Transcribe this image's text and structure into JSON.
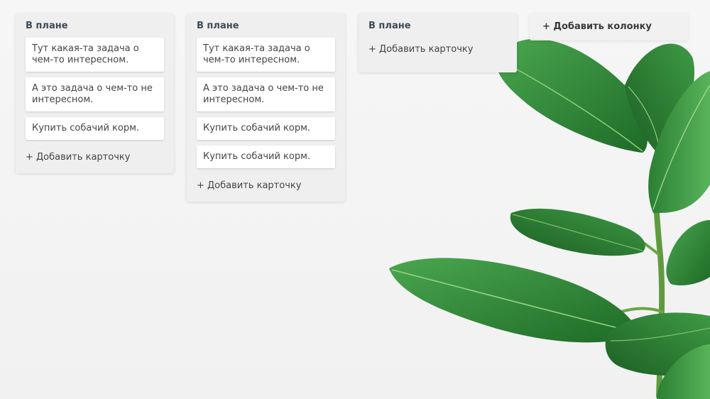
{
  "board": {
    "columns": [
      {
        "title": "В плане",
        "cards": [
          "Тут какая-та задача о чем-то интересном.",
          "А это задача о чем-то не интересном.",
          "Купить собачий корм."
        ],
        "add_card_label": "+ Добавить карточку"
      },
      {
        "title": "В плане",
        "cards": [
          "Тут какая-та задача о чем-то интересном.",
          "А это задача о чем-то не интересном.",
          "Купить собачий корм.",
          "Купить собачий корм."
        ],
        "add_card_label": "+ Добавить карточку"
      },
      {
        "title": "В плане",
        "cards": [],
        "add_card_label": "+ Добавить карточку"
      }
    ],
    "add_column_label": "+ Добавить колонку"
  },
  "background": {
    "image": "ficus-plant",
    "leaf_color": "#2e8b3a",
    "leaf_dark_color": "#1f6b2a"
  }
}
